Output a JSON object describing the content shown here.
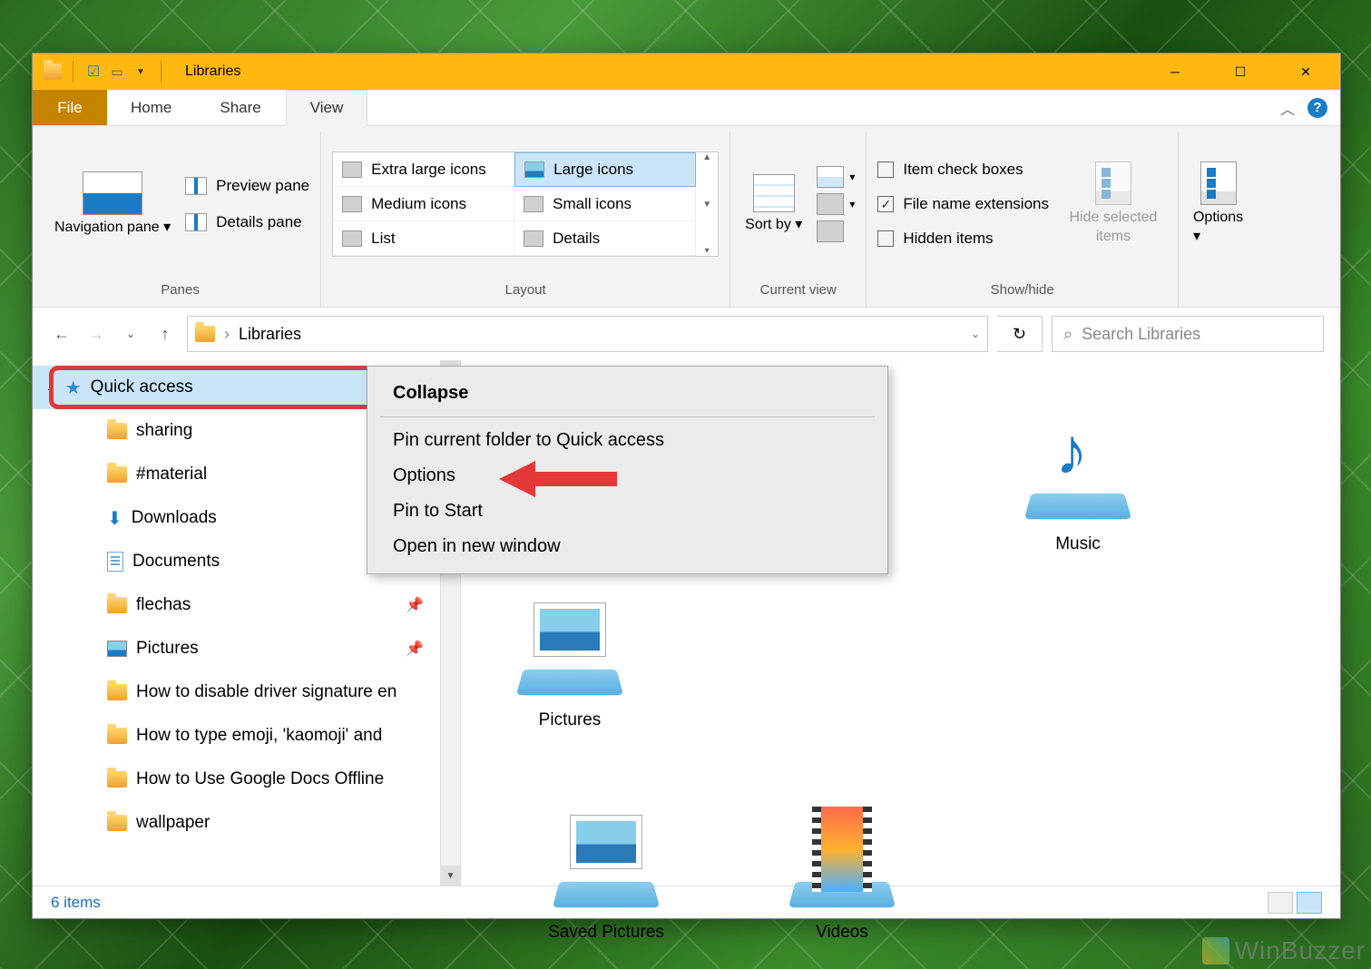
{
  "titlebar": {
    "title": "Libraries"
  },
  "tabs": {
    "file": "File",
    "home": "Home",
    "share": "Share",
    "view": "View"
  },
  "ribbon": {
    "panes": {
      "nav": "Navigation pane",
      "preview": "Preview pane",
      "details": "Details pane",
      "label": "Panes"
    },
    "layout": {
      "xl": "Extra large icons",
      "large": "Large icons",
      "medium": "Medium icons",
      "small": "Small icons",
      "list": "List",
      "details": "Details",
      "label": "Layout"
    },
    "currentview": {
      "sort": "Sort by",
      "label": "Current view"
    },
    "showhide": {
      "checkboxes": "Item check boxes",
      "extensions": "File name extensions",
      "hidden": "Hidden items",
      "hideselected": "Hide selected items",
      "label": "Show/hide"
    },
    "options": "Options"
  },
  "address": {
    "location": "Libraries"
  },
  "search": {
    "placeholder": "Search Libraries"
  },
  "sidebar": {
    "quick_access": "Quick access",
    "items": [
      {
        "label": "sharing",
        "icon": "folder"
      },
      {
        "label": "#material",
        "icon": "folder"
      },
      {
        "label": "Downloads",
        "icon": "download"
      },
      {
        "label": "Documents",
        "icon": "document"
      },
      {
        "label": "flechas",
        "icon": "folder",
        "pinned": true
      },
      {
        "label": "Pictures",
        "icon": "picture",
        "pinned": true
      },
      {
        "label": "How to disable driver signature en",
        "icon": "folder"
      },
      {
        "label": "How to type emoji, 'kaomoji' and",
        "icon": "folder"
      },
      {
        "label": "How to Use Google Docs Offline",
        "icon": "folder"
      },
      {
        "label": "wallpaper",
        "icon": "folder"
      }
    ]
  },
  "libraries": [
    {
      "label": "Music",
      "kind": "music"
    },
    {
      "label": "Pictures",
      "kind": "pictures"
    },
    {
      "label": "Saved Pictures",
      "kind": "pictures"
    },
    {
      "label": "Videos",
      "kind": "videos"
    }
  ],
  "context_menu": {
    "collapse": "Collapse",
    "pin_current": "Pin current folder to Quick access",
    "options": "Options",
    "pin_start": "Pin to Start",
    "new_window": "Open in new window"
  },
  "status": {
    "count": "6 items"
  },
  "watermark": "WinBuzzer"
}
